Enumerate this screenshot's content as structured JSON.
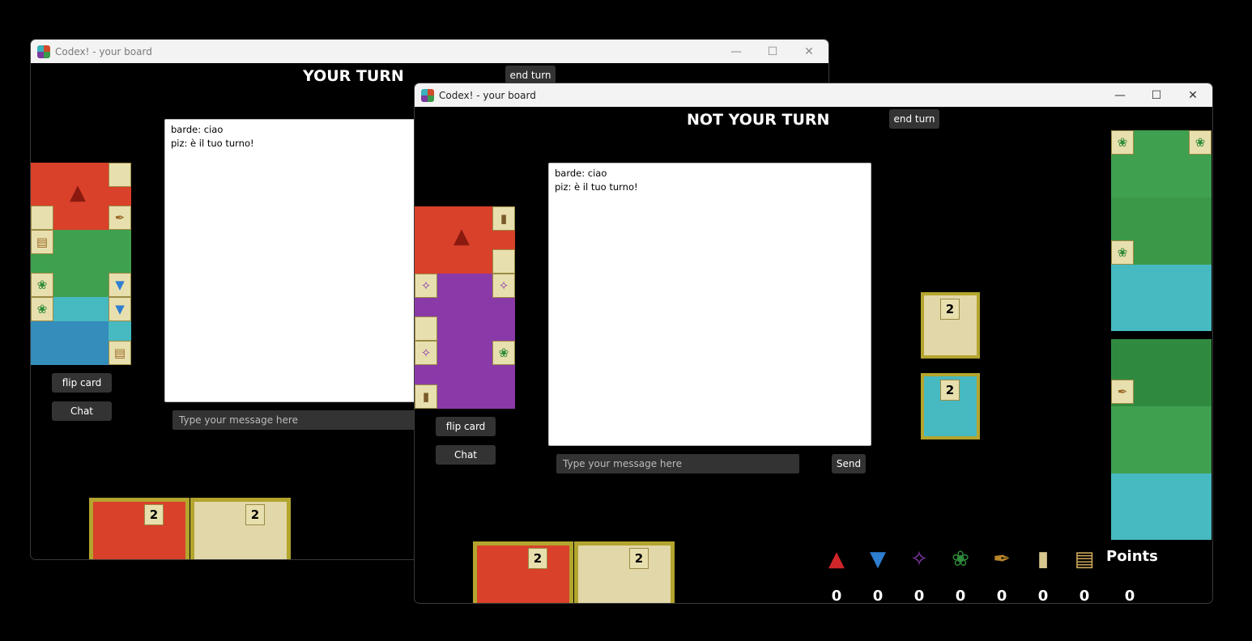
{
  "back_window": {
    "title": "Codex! - your board",
    "turn_label": "YOUR TURN",
    "end_turn_label": "end turn",
    "flip_card_label": "flip card",
    "chat_label": "Chat",
    "chat_messages": [
      "barde: ciao",
      "piz: è il tuo turno!"
    ],
    "chat_placeholder": "Type your message here",
    "hand_cards": [
      {
        "points": "2"
      },
      {
        "points": "2"
      }
    ]
  },
  "front_window": {
    "title": "Codex! - your board",
    "turn_label": "NOT YOUR TURN",
    "end_turn_label": "end turn",
    "flip_card_label": "flip card",
    "chat_label": "Chat",
    "chat_messages": [
      "barde: ciao",
      "piz: è il tuo turno!"
    ],
    "chat_placeholder": "Type your message here",
    "send_label": "Send",
    "common_objective_cards": [
      {
        "points": "2"
      },
      {
        "points": "2"
      }
    ],
    "hand_cards": [
      {
        "points": "2"
      },
      {
        "points": "2"
      }
    ],
    "resources": [
      {
        "icon": "mushroom-icon",
        "value": "0",
        "color": "#d0262a"
      },
      {
        "icon": "wolf-icon",
        "value": "0",
        "color": "#2f7fd0"
      },
      {
        "icon": "butterfly-icon",
        "value": "0",
        "color": "#8a3ab0"
      },
      {
        "icon": "leaf-icon",
        "value": "0",
        "color": "#2e8a3a"
      },
      {
        "icon": "quill-icon",
        "value": "0",
        "color": "#b8862a"
      },
      {
        "icon": "inkwell-icon",
        "value": "0",
        "color": "#d8c890"
      },
      {
        "icon": "scroll-icon",
        "value": "0",
        "color": "#d8b060"
      }
    ],
    "points_label": "Points",
    "points_value": "0"
  },
  "colors": {
    "fungi": "#d9412a",
    "plant": "#3fa04f",
    "animal": "#47b9c0",
    "insect": "#8a3aa8",
    "gold": "#b3a52e",
    "corner": "#e8dfae"
  }
}
